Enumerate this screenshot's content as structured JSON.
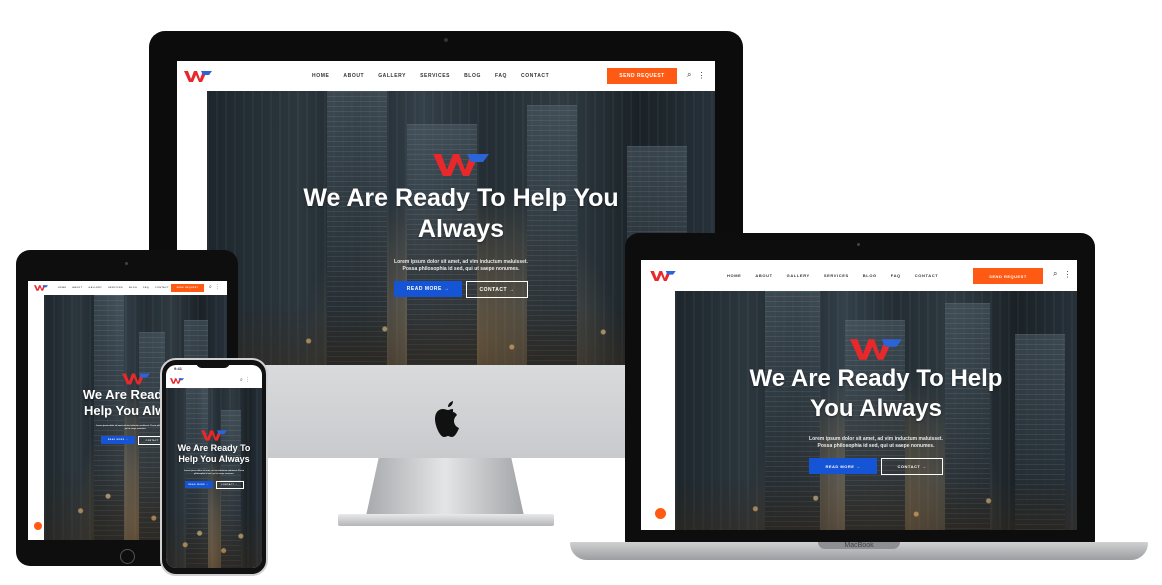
{
  "nav": {
    "items": [
      "HOME",
      "ABOUT",
      "GALLERY",
      "SERVICES",
      "BLOG",
      "FAQ",
      "CONTACT"
    ],
    "cta_label": "SEND REQUEST",
    "search_icon": "search-icon",
    "more_icon": "vertical-dots-icon"
  },
  "hero": {
    "title_desktop": "We Are Ready To Help You Always",
    "title_laptop": "We Are Ready To Help You Always",
    "title_tablet": "We Are Ready To Help You Always",
    "title_phone": "We Are Ready To Help You Always",
    "subtitle": "Lorem ipsum dolor sit amet, ad vim inductum maluisset. Possa philosophia id sed, qui ut saepe nonumes.",
    "read_more_label": "READ MORE",
    "contact_label": "CONTACT",
    "arrow_glyph": "→"
  },
  "devices": {
    "laptop_brand": "MacBook",
    "phone_time": "9:41"
  },
  "colors": {
    "accent": "#ff5a14",
    "primary_blue": "#1554d4",
    "logo_red": "#e8282b",
    "logo_blue": "#2b63d9"
  }
}
